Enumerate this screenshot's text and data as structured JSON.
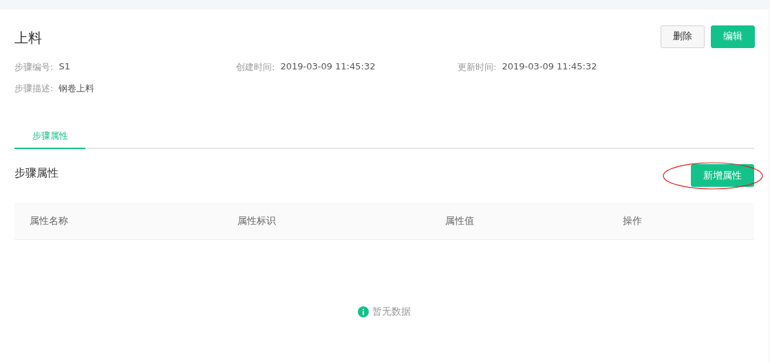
{
  "title": "上料",
  "actions": [
    {
      "label": "删除",
      "kind": "default"
    },
    {
      "label": "编辑",
      "kind": "primary"
    }
  ],
  "info_rows": [
    [
      {
        "label": "步骤编号:",
        "value": "S1"
      },
      {
        "label": "创建时间:",
        "value": "2019-03-09 11:45:32"
      },
      {
        "label": "更新时间:",
        "value": "2019-03-09 11:45:32"
      }
    ],
    [
      {
        "label": "步骤描述:",
        "value": "钢卷上料"
      }
    ]
  ],
  "tabs": [
    {
      "label": "步骤属性",
      "selected": true
    }
  ],
  "section": {
    "title": "步骤属性",
    "add_button": {
      "label": "新增属性",
      "highlighted": true
    }
  },
  "table": {
    "columns": [
      "属性名称",
      "属性标识",
      "属性值",
      "操作"
    ],
    "empty_text": "暂无数据"
  }
}
